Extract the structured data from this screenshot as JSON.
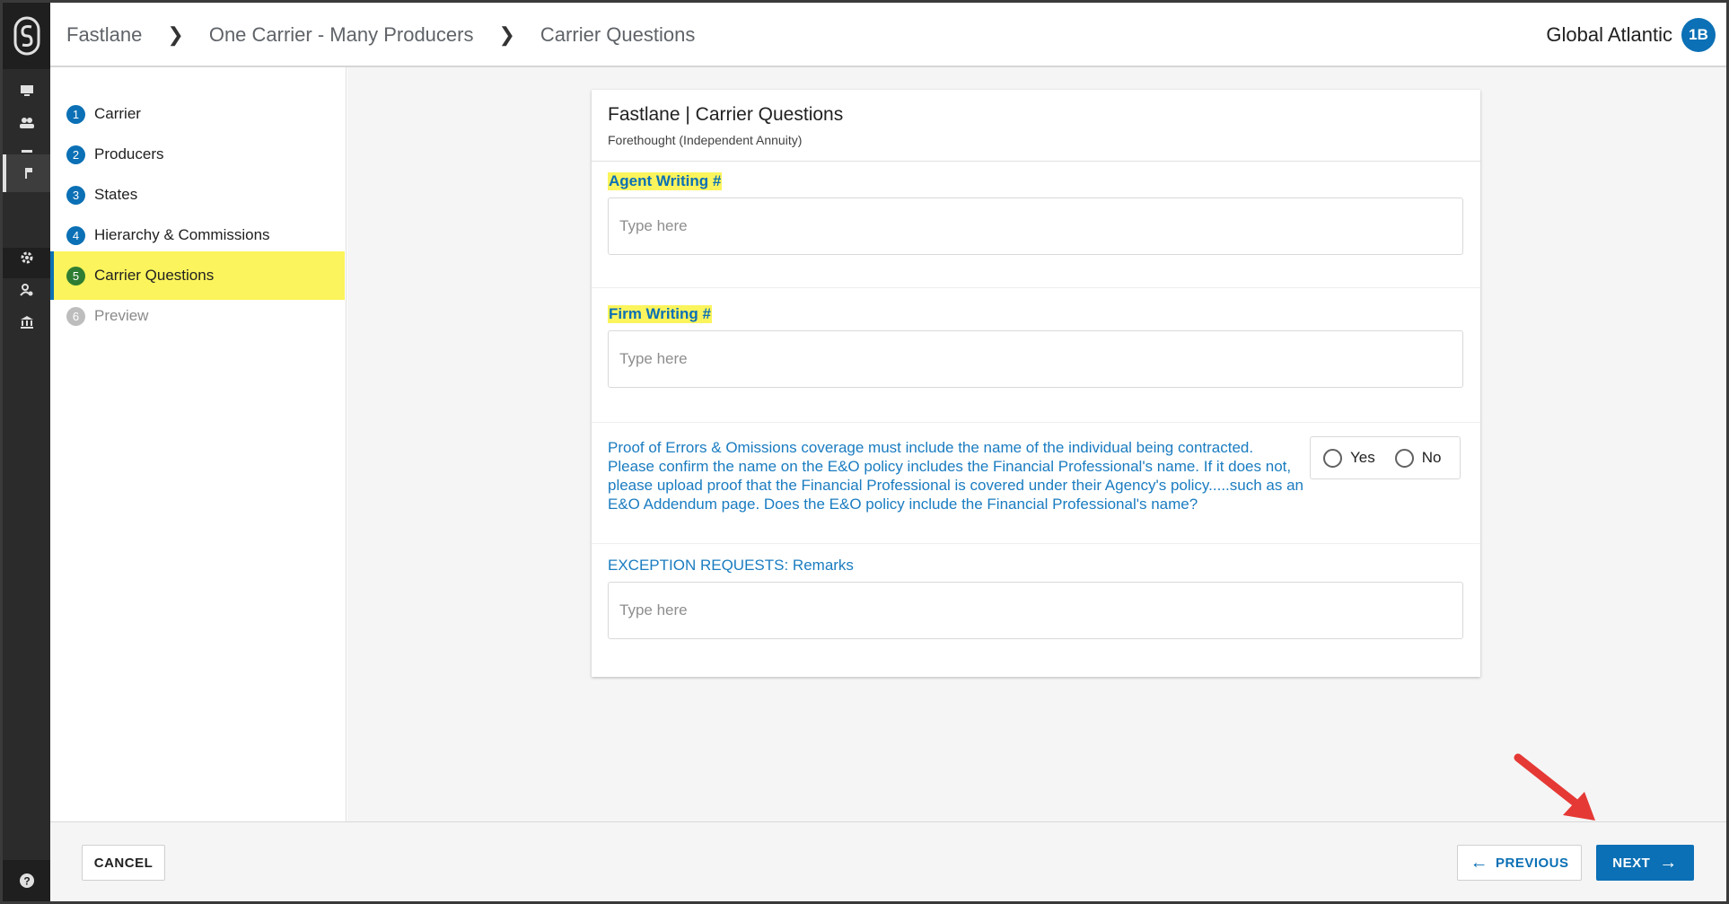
{
  "header": {
    "breadcrumbs": [
      "Fastlane",
      "One Carrier - Many Producers",
      "Carrier Questions"
    ],
    "org_name": "Global Atlantic",
    "avatar_initials": "1B",
    "avatar_color": "#0b70b5"
  },
  "rail": {
    "icons": [
      "monitor-icon",
      "people-icon",
      "store-icon",
      "flag-icon",
      "gear-icon",
      "user-settings-icon",
      "bank-icon",
      "help-icon"
    ]
  },
  "steps": [
    {
      "num": "1",
      "label": "Carrier"
    },
    {
      "num": "2",
      "label": "Producers"
    },
    {
      "num": "3",
      "label": "States"
    },
    {
      "num": "4",
      "label": "Hierarchy & Commissions"
    },
    {
      "num": "5",
      "label": "Carrier Questions"
    },
    {
      "num": "6",
      "label": "Preview"
    }
  ],
  "form": {
    "title": "Fastlane | Carrier Questions",
    "subtitle": "Forethought (Independent Annuity)",
    "agent_writing_label": "Agent Writing #",
    "agent_writing_placeholder": "Type here",
    "firm_writing_label": "Firm Writing #",
    "firm_writing_placeholder": "Type here",
    "eo_question": "Proof of Errors & Omissions coverage must include the name of the individual being contracted. Please confirm the name on the E&O policy includes the Financial Professional's name. If it does not, please upload proof that the Financial Professional is covered under their Agency's policy.....such as an E&O Addendum page. Does the E&O policy include the Financial Professional's name?",
    "yes_label": "Yes",
    "no_label": "No",
    "exception_label": "EXCEPTION REQUESTS: Remarks",
    "exception_placeholder": "Type here"
  },
  "footer": {
    "cancel_label": "CANCEL",
    "previous_label": "PREVIOUS",
    "next_label": "NEXT"
  },
  "colors": {
    "accent": "#0b70b5",
    "highlight": "#fbf45c",
    "active_step": "#2e7d32",
    "annotation_arrow": "#e53935"
  }
}
